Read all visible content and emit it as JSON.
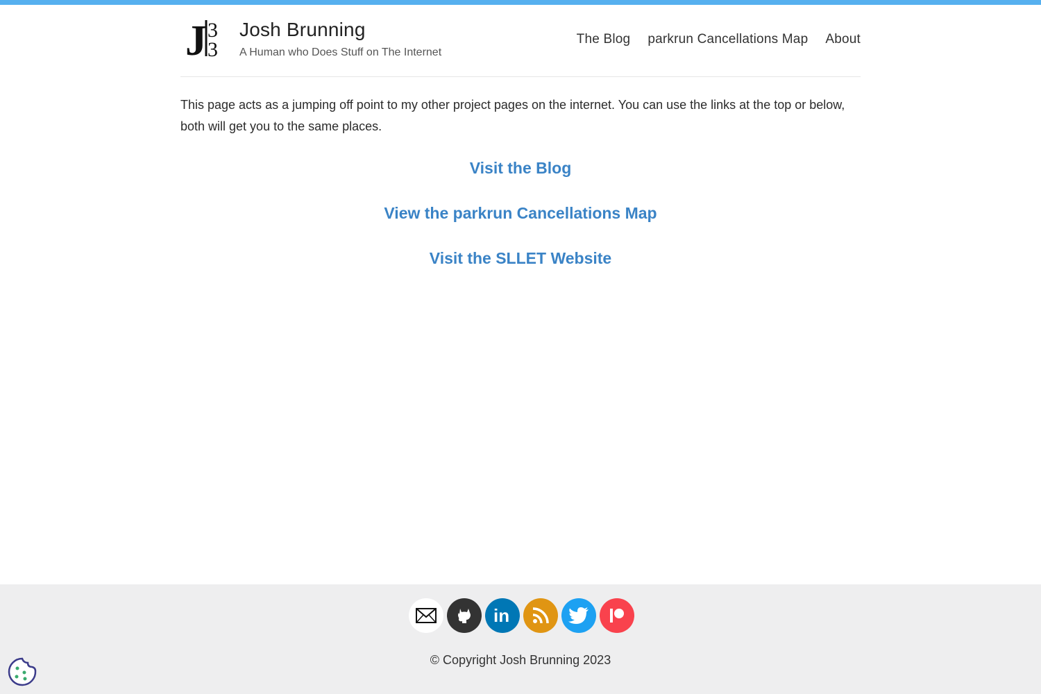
{
  "header": {
    "logo_alt": "JB",
    "title": "Josh Brunning",
    "subtitle": "A Human who Does Stuff on The Internet"
  },
  "nav": {
    "items": [
      {
        "label": "The Blog"
      },
      {
        "label": "parkrun Cancellations Map"
      },
      {
        "label": "About"
      }
    ]
  },
  "main": {
    "intro": "This page acts as a jumping off point to my other project pages on the internet. You can use the links at the top or below, both will get you to the same places.",
    "links": [
      {
        "label": "Visit the Blog"
      },
      {
        "label": "View the parkrun Cancellations Map"
      },
      {
        "label": "Visit the SLLET Website"
      }
    ]
  },
  "footer": {
    "social": [
      {
        "icon": "email-icon",
        "color": "#ffffff"
      },
      {
        "icon": "github-icon",
        "color": "#333333"
      },
      {
        "icon": "linkedin-icon",
        "color": "#0077b5"
      },
      {
        "icon": "rss-icon",
        "color": "#e09513"
      },
      {
        "icon": "twitter-icon",
        "color": "#1da1f2"
      },
      {
        "icon": "patreon-icon",
        "color": "#f9424d"
      }
    ],
    "copyright": "© Copyright Josh Brunning 2023"
  },
  "colors": {
    "accent_bar": "#56b0ef",
    "link": "#3a83c6",
    "footer_bg": "#eeeeef"
  }
}
